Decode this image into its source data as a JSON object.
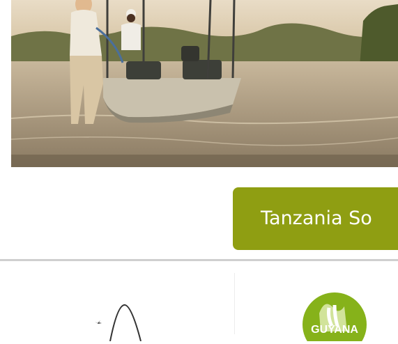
{
  "hero": {
    "image": "safari-boat-river-photo"
  },
  "cta": {
    "label": "Tanzania So"
  },
  "logos": {
    "left": "bird-mountain-logo",
    "right": "green-circle-logo",
    "right_text": "GUYANA"
  },
  "colors": {
    "cta_bg": "#8f9e12",
    "logo_green": "#86b21a",
    "divider": "#cfcfcf"
  }
}
